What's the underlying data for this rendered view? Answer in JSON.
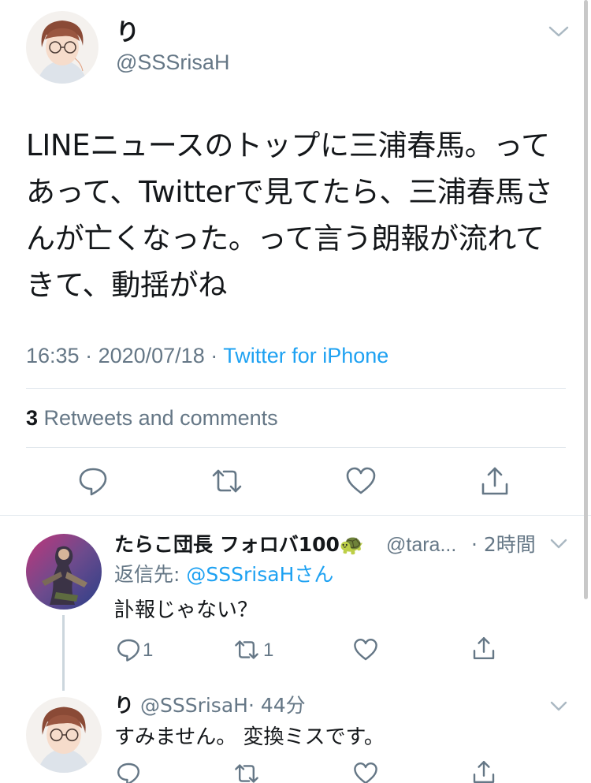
{
  "main_tweet": {
    "name": "り",
    "handle": "@SSSrisaH",
    "text": "LINEニュースのトップに三浦春馬。ってあって、Twitterで見てたら、三浦春馬さんが亡くなった。って言う朗報が流れてきて、動揺がね",
    "time": "16:35",
    "date": "2020/07/18",
    "source": "Twitter for iPhone",
    "retweets_count": "3",
    "retweets_label": "Retweets and comments",
    "actions": [
      "reply-icon",
      "retweet-icon",
      "like-icon",
      "share-icon"
    ]
  },
  "reply": {
    "name": "たらこ団長 フォロバ100🐢",
    "handle": "@tara...",
    "time": "· 2時間",
    "reply_to_label": "返信先:",
    "reply_to_user": "@SSSrisaHさん",
    "text": "訃報じゃない？",
    "reply_count": "1",
    "retweet_count": "1"
  },
  "reply2": {
    "name": "り",
    "handle": "@SSSrisaH",
    "time": "· 44分",
    "text": "すみません。 変換ミスです。"
  },
  "colors": {
    "accent": "#1da1f2",
    "secondary_text": "#657786",
    "divider": "#e1e8ed"
  }
}
